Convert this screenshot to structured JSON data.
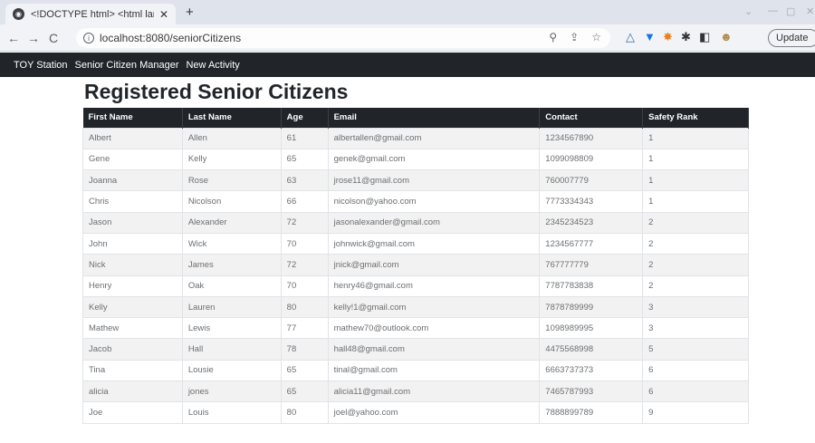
{
  "browser": {
    "tab_title": "<!DOCTYPE html> <html lang=\"",
    "url": "localhost:8080/seniorCitizens",
    "update_label": "Update"
  },
  "navbar": {
    "brand": "TOY Station",
    "links": [
      "Senior Citizen Manager",
      "New Activity"
    ]
  },
  "page": {
    "heading": "Registered Senior Citizens"
  },
  "table": {
    "columns": [
      "First Name",
      "Last Name",
      "Age",
      "Email",
      "Contact",
      "Safety Rank"
    ],
    "rows": [
      [
        "Albert",
        "Allen",
        "61",
        "albertallen@gmail.com",
        "1234567890",
        "1"
      ],
      [
        "Gene",
        "Kelly",
        "65",
        "genek@gmail.com",
        "1099098809",
        "1"
      ],
      [
        "Joanna",
        "Rose",
        "63",
        "jrose11@gmail.com",
        "760007779",
        "1"
      ],
      [
        "Chris",
        "Nicolson",
        "66",
        "nicolson@yahoo.com",
        "7773334343",
        "1"
      ],
      [
        "Jason",
        "Alexander",
        "72",
        "jasonalexander@gmail.com",
        "2345234523",
        "2"
      ],
      [
        "John",
        "Wick",
        "70",
        "johnwick@gmail.com",
        "1234567777",
        "2"
      ],
      [
        "Nick",
        "James",
        "72",
        "jnick@gmail.com",
        "767777779",
        "2"
      ],
      [
        "Henry",
        "Oak",
        "70",
        "henry46@gmail.com",
        "7787783838",
        "2"
      ],
      [
        "Kelly",
        "Lauren",
        "80",
        "kelly!1@gmail.com",
        "7878789999",
        "3"
      ],
      [
        "Mathew",
        "Lewis",
        "77",
        "mathew70@outlook.com",
        "1098989995",
        "3"
      ],
      [
        "Jacob",
        "Hall",
        "78",
        "hall48@gmail.com",
        "4475568998",
        "5"
      ],
      [
        "Tina",
        "Lousie",
        "65",
        "tinal@gmail.com",
        "6663737373",
        "6"
      ],
      [
        "alicia",
        "jones",
        "65",
        "alicia11@gmail.com",
        "7465787993",
        "6"
      ],
      [
        "Joe",
        "Louis",
        "80",
        "joel@yahoo.com",
        "7888899789",
        "9"
      ]
    ]
  }
}
